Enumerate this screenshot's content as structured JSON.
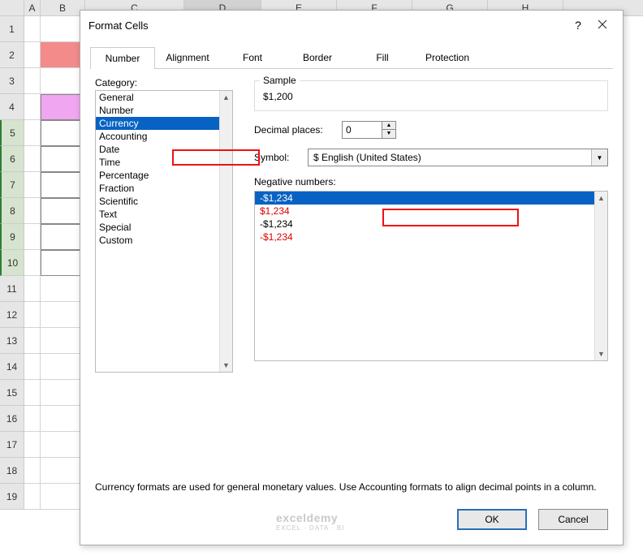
{
  "sheet": {
    "columns": [
      "A",
      "B",
      "C",
      "D",
      "E",
      "F",
      "G",
      "H"
    ],
    "rows": [
      "1",
      "2",
      "3",
      "4",
      "5",
      "6",
      "7",
      "8",
      "9",
      "10",
      "11",
      "12",
      "13",
      "14",
      "15",
      "16",
      "17",
      "18",
      "19"
    ]
  },
  "dialog": {
    "title": "Format Cells",
    "help": "?",
    "tabs": [
      "Number",
      "Alignment",
      "Font",
      "Border",
      "Fill",
      "Protection"
    ],
    "active_tab": "Number",
    "category_label": "Category:",
    "categories": [
      "General",
      "Number",
      "Currency",
      "Accounting",
      "Date",
      "Time",
      "Percentage",
      "Fraction",
      "Scientific",
      "Text",
      "Special",
      "Custom"
    ],
    "selected_category": "Currency",
    "sample_label": "Sample",
    "sample_value": "$1,200",
    "decimal_label": "Decimal places:",
    "decimal_value": "0",
    "symbol_label": "Symbol:",
    "symbol_value": "$ English (United States)",
    "negative_label": "Negative numbers:",
    "negative_numbers": [
      {
        "text": "-$1,234",
        "cls": "selected"
      },
      {
        "text": "$1,234",
        "cls": "red"
      },
      {
        "text": "-$1,234",
        "cls": ""
      },
      {
        "text": "-$1,234",
        "cls": "red"
      }
    ],
    "description": "Currency formats are used for general monetary values.  Use Accounting formats to align decimal points in a column.",
    "ok": "OK",
    "cancel": "Cancel"
  },
  "watermark": {
    "brand": "exceldemy",
    "sub": "EXCEL · DATA · BI"
  }
}
